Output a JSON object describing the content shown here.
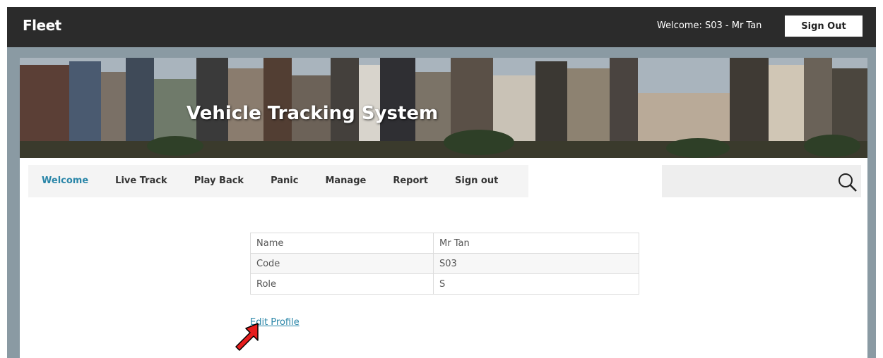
{
  "header": {
    "brand": "Fleet",
    "welcome_text": "Welcome: S03 - Mr Tan",
    "sign_out_label": "Sign Out"
  },
  "banner": {
    "title": "Vehicle Tracking System"
  },
  "nav": {
    "items": [
      {
        "label": "Welcome",
        "active": true
      },
      {
        "label": "Live Track"
      },
      {
        "label": "Play Back"
      },
      {
        "label": "Panic"
      },
      {
        "label": "Manage"
      },
      {
        "label": "Report"
      },
      {
        "label": "Sign out"
      }
    ]
  },
  "search": {
    "value": "",
    "icon": "magnifier"
  },
  "profile": {
    "rows": [
      {
        "key": "Name",
        "value": "Mr Tan"
      },
      {
        "key": "Code",
        "value": "S03"
      },
      {
        "key": "Role",
        "value": "S"
      }
    ]
  },
  "edit_profile_label": "Edit Profile",
  "annotation": {
    "icon": "red-arrow",
    "color": "#e51d1d"
  },
  "colors": {
    "topbar": "#2b2b2b",
    "accent": "#2a86a8",
    "frame": "#8a9aa3"
  }
}
